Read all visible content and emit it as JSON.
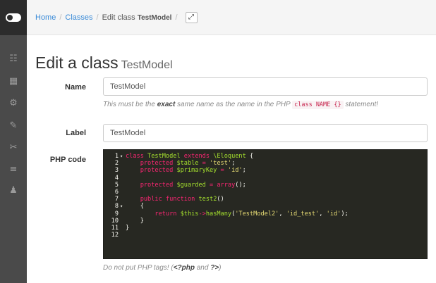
{
  "sidebar": {
    "icons": [
      "sitemap-icon",
      "table-icon",
      "cogs-icon",
      "pencil-icon",
      "paperclip-icon",
      "list-icon",
      "users-icon"
    ]
  },
  "breadcrumb": {
    "home": "Home",
    "classes": "Classes",
    "current_prefix": "Edit class",
    "current_name": "TestModel",
    "expand_icon": "expand-icon"
  },
  "page": {
    "title": "Edit a class",
    "title_sub": "TestModel"
  },
  "form": {
    "name_label": "Name",
    "name_value": "TestModel",
    "name_help_pre": "This must be the ",
    "name_help_bold": "exact",
    "name_help_mid": " same name as the name in the PHP ",
    "name_help_code": "class NAME {}",
    "name_help_post": " statement!",
    "label_label": "Label",
    "label_value": "TestModel",
    "php_label": "PHP code",
    "php_help_pre": "Do not put PHP tags! (",
    "php_help_open": "<?php",
    "php_help_and": " and ",
    "php_help_close": "?>",
    "php_help_post": ")"
  },
  "code_lines": [
    {
      "n": "1",
      "fold": "▾"
    },
    {
      "n": "2",
      "fold": ""
    },
    {
      "n": "3",
      "fold": ""
    },
    {
      "n": "4",
      "fold": ""
    },
    {
      "n": "5",
      "fold": ""
    },
    {
      "n": "6",
      "fold": ""
    },
    {
      "n": "7",
      "fold": ""
    },
    {
      "n": "8",
      "fold": "▾"
    },
    {
      "n": "9",
      "fold": ""
    },
    {
      "n": "10",
      "fold": ""
    },
    {
      "n": "11",
      "fold": ""
    },
    {
      "n": "12",
      "fold": ""
    }
  ],
  "code_tokens": {
    "l1_class": "class ",
    "l1_name": "TestModel",
    "l1_extends": " extends ",
    "l1_parent": "\\Eloquent",
    "l1_brace": " {",
    "l2_protected": "    protected ",
    "l2_var": "$table",
    "l2_eq": " = ",
    "l2_str": "'test'",
    "l2_semi": ";",
    "l3_protected": "    protected ",
    "l3_var": "$primaryKey",
    "l3_eq": " = ",
    "l3_str": "'id'",
    "l3_semi": ";",
    "l5_protected": "    protected ",
    "l5_var": "$guarded",
    "l5_eq": " = ",
    "l5_fn": "array",
    "l5_end": "();",
    "l7_public": "    public ",
    "l7_function": "function ",
    "l7_name": "test2",
    "l7_end": "()",
    "l8": "    {",
    "l9_return": "        return ",
    "l9_this": "$this",
    "l9_arrow": "->",
    "l9_method": "hasMany",
    "l9_open": "(",
    "l9_s1": "'TestModel2'",
    "l9_c1": ", ",
    "l9_s2": "'id_test'",
    "l9_c2": ", ",
    "l9_s3": "'id'",
    "l9_close": ");",
    "l10": "    }",
    "l11": "}"
  }
}
